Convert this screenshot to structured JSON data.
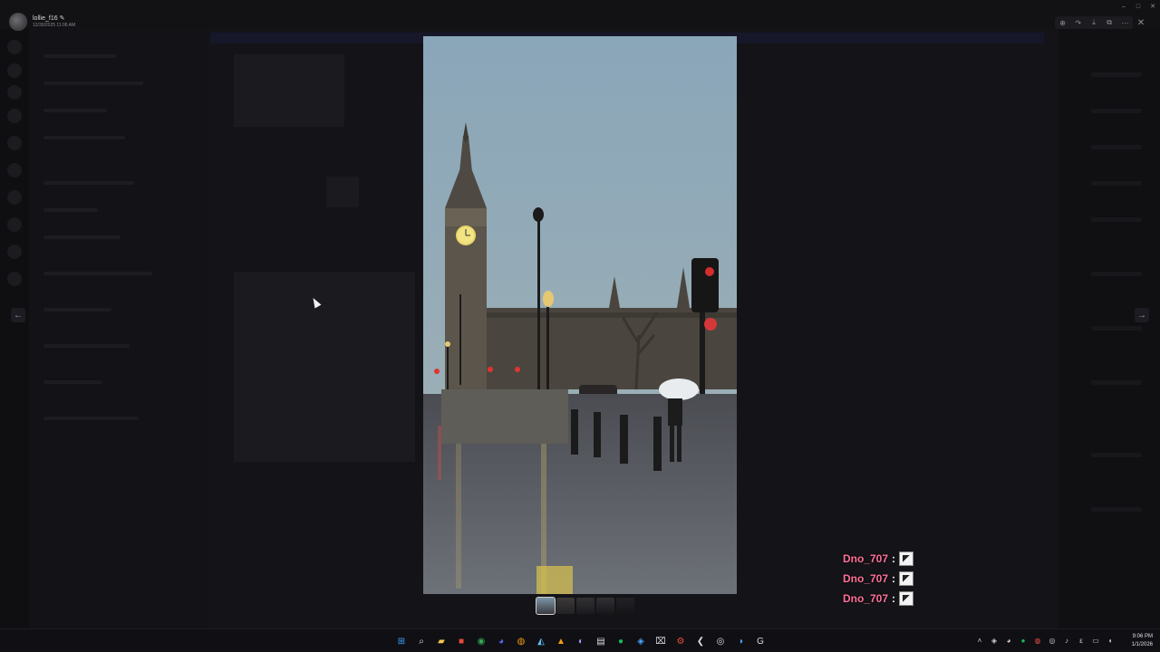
{
  "uploader": {
    "name": "lollie_f16 ✎",
    "timestamp": "12/30/2025 11:06 AM"
  },
  "toolbar": {
    "zoom_icon": "zoom-icon",
    "forward_icon": "forward-icon",
    "download_icon": "download-icon",
    "open_icon": "open-in-browser-icon",
    "more_icon": "more-icon",
    "close_icon": "close-icon"
  },
  "photo": {
    "subject": "Big Ben and Houses of Parliament on a rainy evening"
  },
  "navigation": {
    "prev_glyph": "←",
    "next_glyph": "→"
  },
  "chat_feed": [
    {
      "name": "Dno_707",
      "sep": ":"
    },
    {
      "name": "Dno_707",
      "sep": ":"
    },
    {
      "name": "Dno_707",
      "sep": ":"
    }
  ],
  "taskbar": {
    "clock_time": "9:06 PM",
    "clock_date": "1/1/2026"
  },
  "colors": {
    "feed_name": "#ff6f96",
    "sky": "#8ea8b8"
  }
}
